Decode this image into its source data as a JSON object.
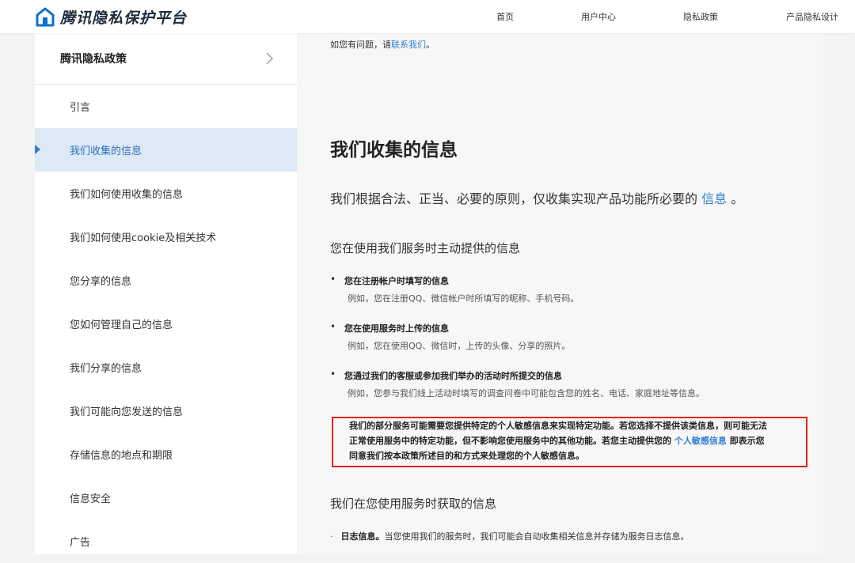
{
  "header": {
    "logo_text": "腾讯隐私保护平台",
    "logo_icon": "house-icon",
    "brand_color": "#0a6fd6",
    "nav": [
      "首页",
      "用户中心",
      "隐私政策",
      "产品隐私设计"
    ]
  },
  "sidebar": {
    "title": "腾讯隐私政策",
    "chevron_icon": "chevron-right-icon",
    "active_index": 1,
    "items": [
      "引言",
      "我们收集的信息",
      "我们如何使用收集的信息",
      "我们如何使用cookie及相关技术",
      "您分享的信息",
      "您如何管理自己的信息",
      "我们分享的信息",
      "我们可能向您发送的信息",
      "存储信息的地点和期限",
      "信息安全",
      "广告"
    ]
  },
  "content": {
    "intro_prefix": "如您有问题，请",
    "intro_link": "联系我们",
    "intro_suffix": "。",
    "section_title": "我们收集的信息",
    "lead_prefix": "我们根据合法、正当、必要的原则，仅收集实现产品功能所必要的",
    "lead_link": "信息",
    "lead_suffix": "。",
    "subsection1": "您在使用我们服务时主动提供的信息",
    "bullets": [
      {
        "title": "您在注册帐户时填写的信息",
        "desc": "例如，您在注册QQ、微信帐户时所填写的昵称、手机号码。"
      },
      {
        "title": "您在使用服务时上传的信息",
        "desc": "例如，您在使用QQ、微信时，上传的头像、分享的照片。"
      },
      {
        "title": "您通过我们的客服或参加我们举办的活动时所提交的信息",
        "desc": "例如，您参与我们线上活动时填写的调查问卷中可能包含您的姓名、电话、家庭地址等信息。"
      }
    ],
    "notice": {
      "line1": "我们的部分服务可能需要您提供特定的个人敏感信息来实现特定功能。若您选择不提供该类信息，则可能无法",
      "line2_prefix": "正常使用服务中的特定功能，但不影响您使用服务中的其他功能。若您主动提供您的",
      "line2_link": "个人敏感信息",
      "line2_suffix": "即表示您",
      "line3": "同意我们按本政策所述目的和方式来处理您的个人敏感信息。",
      "border_color": "#e0241b"
    },
    "subsection2": "我们在您使用服务时获取的信息",
    "log_title": "日志信息。",
    "log_text": "当您使用我们的服务时，我们可能会自动收集相关信息并存储为服务日志信息。"
  }
}
